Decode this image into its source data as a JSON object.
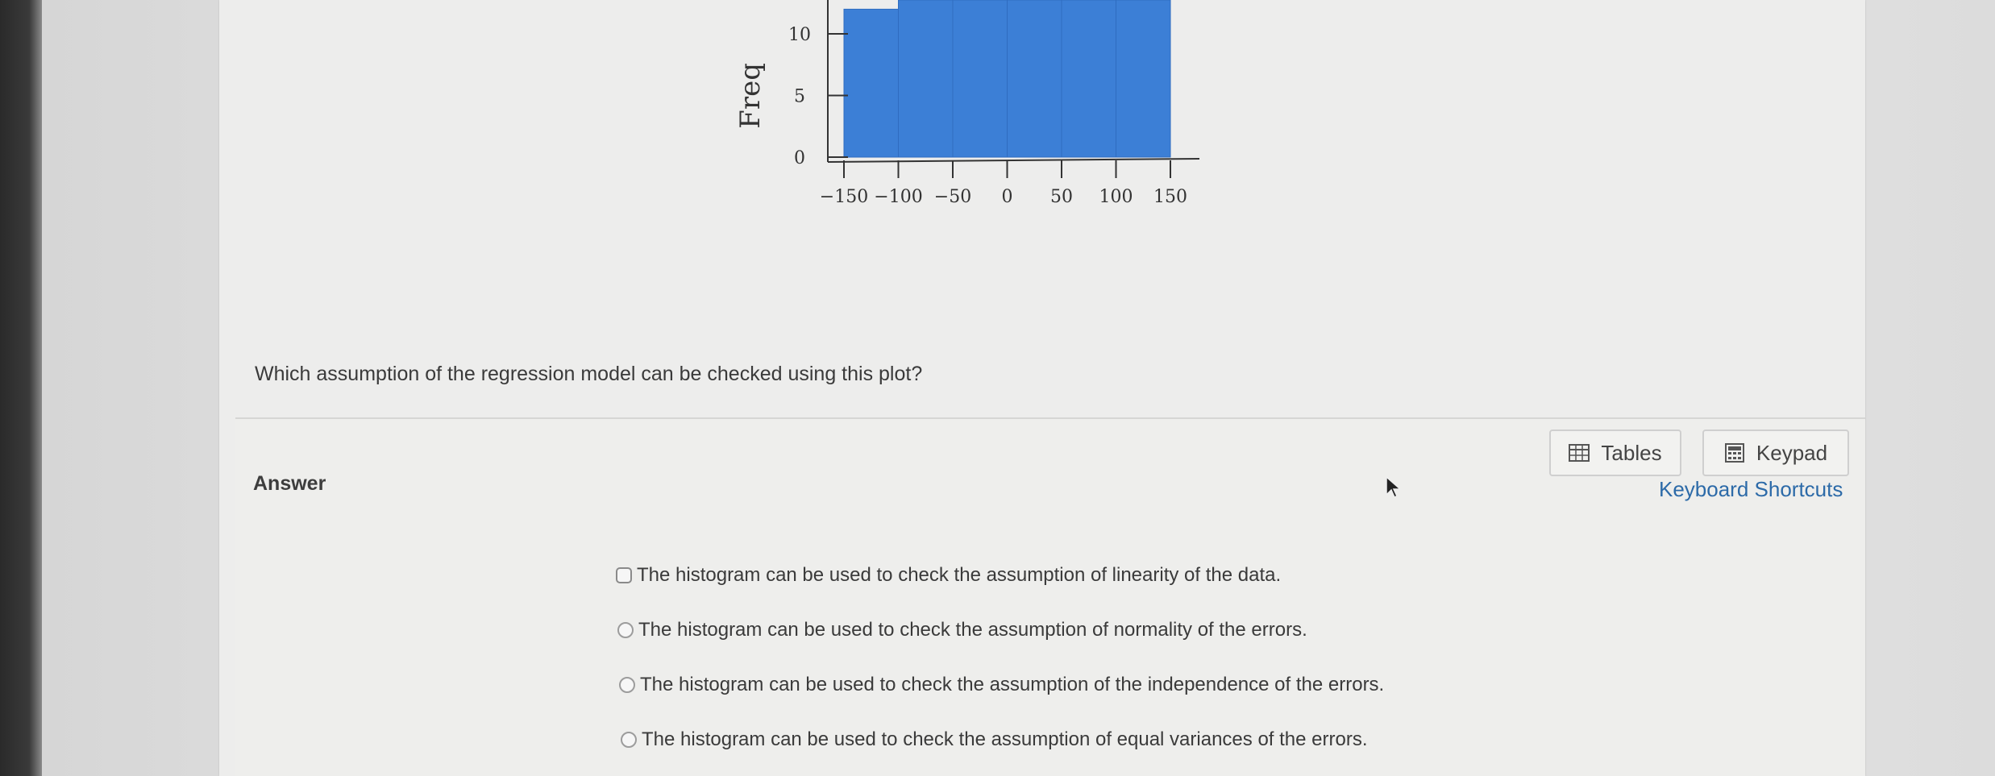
{
  "chart_data": {
    "type": "bar",
    "title": "",
    "xlabel": "",
    "ylabel": "Freq",
    "bin_edges": [
      -150,
      -100,
      -50,
      0,
      50,
      100,
      150
    ],
    "values": [
      12,
      13,
      13,
      13,
      13,
      13
    ],
    "x_ticks": [
      "−150",
      "−100",
      "−50",
      "0",
      "50",
      "100",
      "150"
    ],
    "y_ticks": [
      "0",
      "5",
      "10"
    ],
    "xlim": [
      -150,
      150
    ],
    "ylim": [
      0,
      13
    ],
    "bar_color": "#3c7fd6",
    "grid": false
  },
  "question": {
    "text": "Which assumption of the regression model can be checked using this plot?"
  },
  "answer": {
    "label": "Answer",
    "options": [
      {
        "text": "The histogram can be used to check the assumption of linearity of the data.",
        "selected": false
      },
      {
        "text": "The histogram can be used to check the assumption of normality of the errors.",
        "selected": false
      },
      {
        "text": "The histogram can be used to check the assumption of the independence of the errors.",
        "selected": false
      },
      {
        "text": "The histogram can be used to check the assumption of equal variances of the errors.",
        "selected": false
      }
    ]
  },
  "tools": {
    "tables_label": "Tables",
    "keypad_label": "Keypad",
    "shortcuts_label": "Keyboard Shortcuts",
    "tables_icon": "table-grid-icon",
    "keypad_icon": "calculator-icon"
  },
  "colors": {
    "link": "#2c6aa8",
    "bar": "#3c7fd6"
  }
}
